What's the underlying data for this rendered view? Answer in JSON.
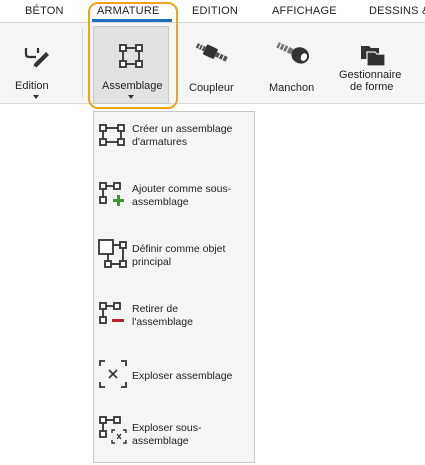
{
  "tabs": [
    {
      "label": "BÉTON"
    },
    {
      "label": "ARMATURE"
    },
    {
      "label": "EDITION"
    },
    {
      "label": "AFFICHAGE"
    },
    {
      "label": "DESSINS &"
    }
  ],
  "ribbon": {
    "edition": {
      "label": "Edition",
      "icon": "pencil-icon"
    },
    "assemblage": {
      "label": "Assemblage",
      "icon": "assembly-icon"
    },
    "coupleur": {
      "label": "Coupleur",
      "icon": "coupler-icon"
    },
    "manchon": {
      "label": "Manchon",
      "icon": "sleeve-icon"
    },
    "gestionnaire": {
      "label_line1": "Gestionnaire",
      "label_line2": "de forme",
      "icon": "shape-manager-icon"
    }
  },
  "menu": {
    "items": [
      {
        "label": "Créer un assemblage\nd'armatures",
        "icon": "create-assembly-icon"
      },
      {
        "label": "Ajouter comme sous-\nassemblage",
        "icon": "add-subassembly-icon"
      },
      {
        "label": "Définir comme objet\nprincipal",
        "icon": "set-main-object-icon"
      },
      {
        "label": "Retirer de\nl'assemblage",
        "icon": "remove-from-assembly-icon"
      },
      {
        "label": "Exploser assemblage",
        "icon": "explode-assembly-icon"
      },
      {
        "label": "Exploser sous-\nassemblage",
        "icon": "explode-subassembly-icon"
      }
    ]
  },
  "colors": {
    "highlight": "#f0a21a",
    "active_tab_underline": "#1f6fbf",
    "add_green": "#3a9a2e",
    "remove_red": "#b8202a"
  }
}
